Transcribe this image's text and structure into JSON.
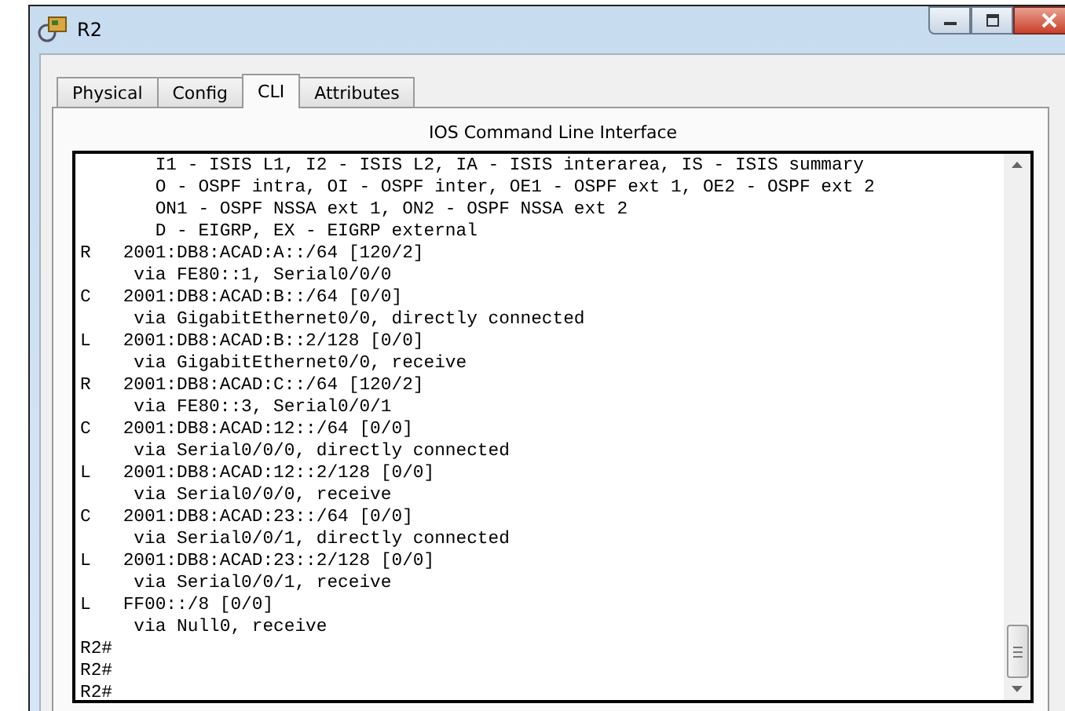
{
  "window": {
    "title": "R2"
  },
  "tabs": [
    {
      "label": "Physical",
      "selected": false
    },
    {
      "label": "Config",
      "selected": false
    },
    {
      "label": "CLI",
      "selected": true
    },
    {
      "label": "Attributes",
      "selected": false
    }
  ],
  "panel": {
    "title": "IOS Command Line Interface"
  },
  "terminal": {
    "lines": [
      "       I1 - ISIS L1, I2 - ISIS L2, IA - ISIS interarea, IS - ISIS summary",
      "       O - OSPF intra, OI - OSPF inter, OE1 - OSPF ext 1, OE2 - OSPF ext 2",
      "       ON1 - OSPF NSSA ext 1, ON2 - OSPF NSSA ext 2",
      "       D - EIGRP, EX - EIGRP external",
      "R   2001:DB8:ACAD:A::/64 [120/2]",
      "     via FE80::1, Serial0/0/0",
      "C   2001:DB8:ACAD:B::/64 [0/0]",
      "     via GigabitEthernet0/0, directly connected",
      "L   2001:DB8:ACAD:B::2/128 [0/0]",
      "     via GigabitEthernet0/0, receive",
      "R   2001:DB8:ACAD:C::/64 [120/2]",
      "     via FE80::3, Serial0/0/1",
      "C   2001:DB8:ACAD:12::/64 [0/0]",
      "     via Serial0/0/0, directly connected",
      "L   2001:DB8:ACAD:12::2/128 [0/0]",
      "     via Serial0/0/0, receive",
      "C   2001:DB8:ACAD:23::/64 [0/0]",
      "     via Serial0/0/1, directly connected",
      "L   2001:DB8:ACAD:23::2/128 [0/0]",
      "     via Serial0/0/1, receive",
      "L   FF00::/8 [0/0]",
      "     via Null0, receive",
      "R2#",
      "R2#",
      "R2#"
    ]
  }
}
